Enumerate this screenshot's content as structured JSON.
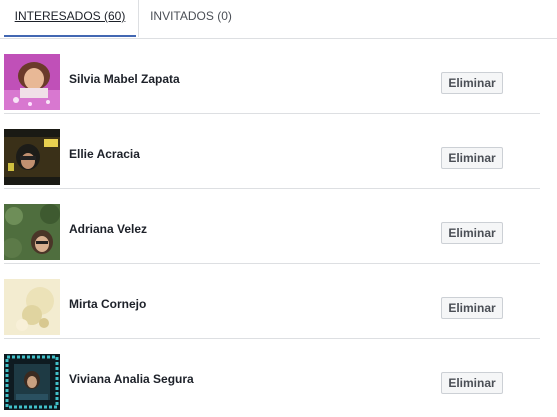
{
  "tabs": [
    {
      "label": "INTERESADOS (60)",
      "active": true
    },
    {
      "label": "INVITADOS (0)",
      "active": false
    }
  ],
  "people": [
    {
      "name": "Silvia Mabel Zapata",
      "action": "Eliminar"
    },
    {
      "name": "Ellie Acracia",
      "action": "Eliminar"
    },
    {
      "name": "Adriana Velez",
      "action": "Eliminar"
    },
    {
      "name": "Mirta Cornejo",
      "action": "Eliminar"
    },
    {
      "name": "Viviana Analia Segura",
      "action": "Eliminar"
    }
  ],
  "colors": {
    "accent": "#4267b2",
    "border": "#dddfe2",
    "button_bg": "#f5f6f7"
  }
}
